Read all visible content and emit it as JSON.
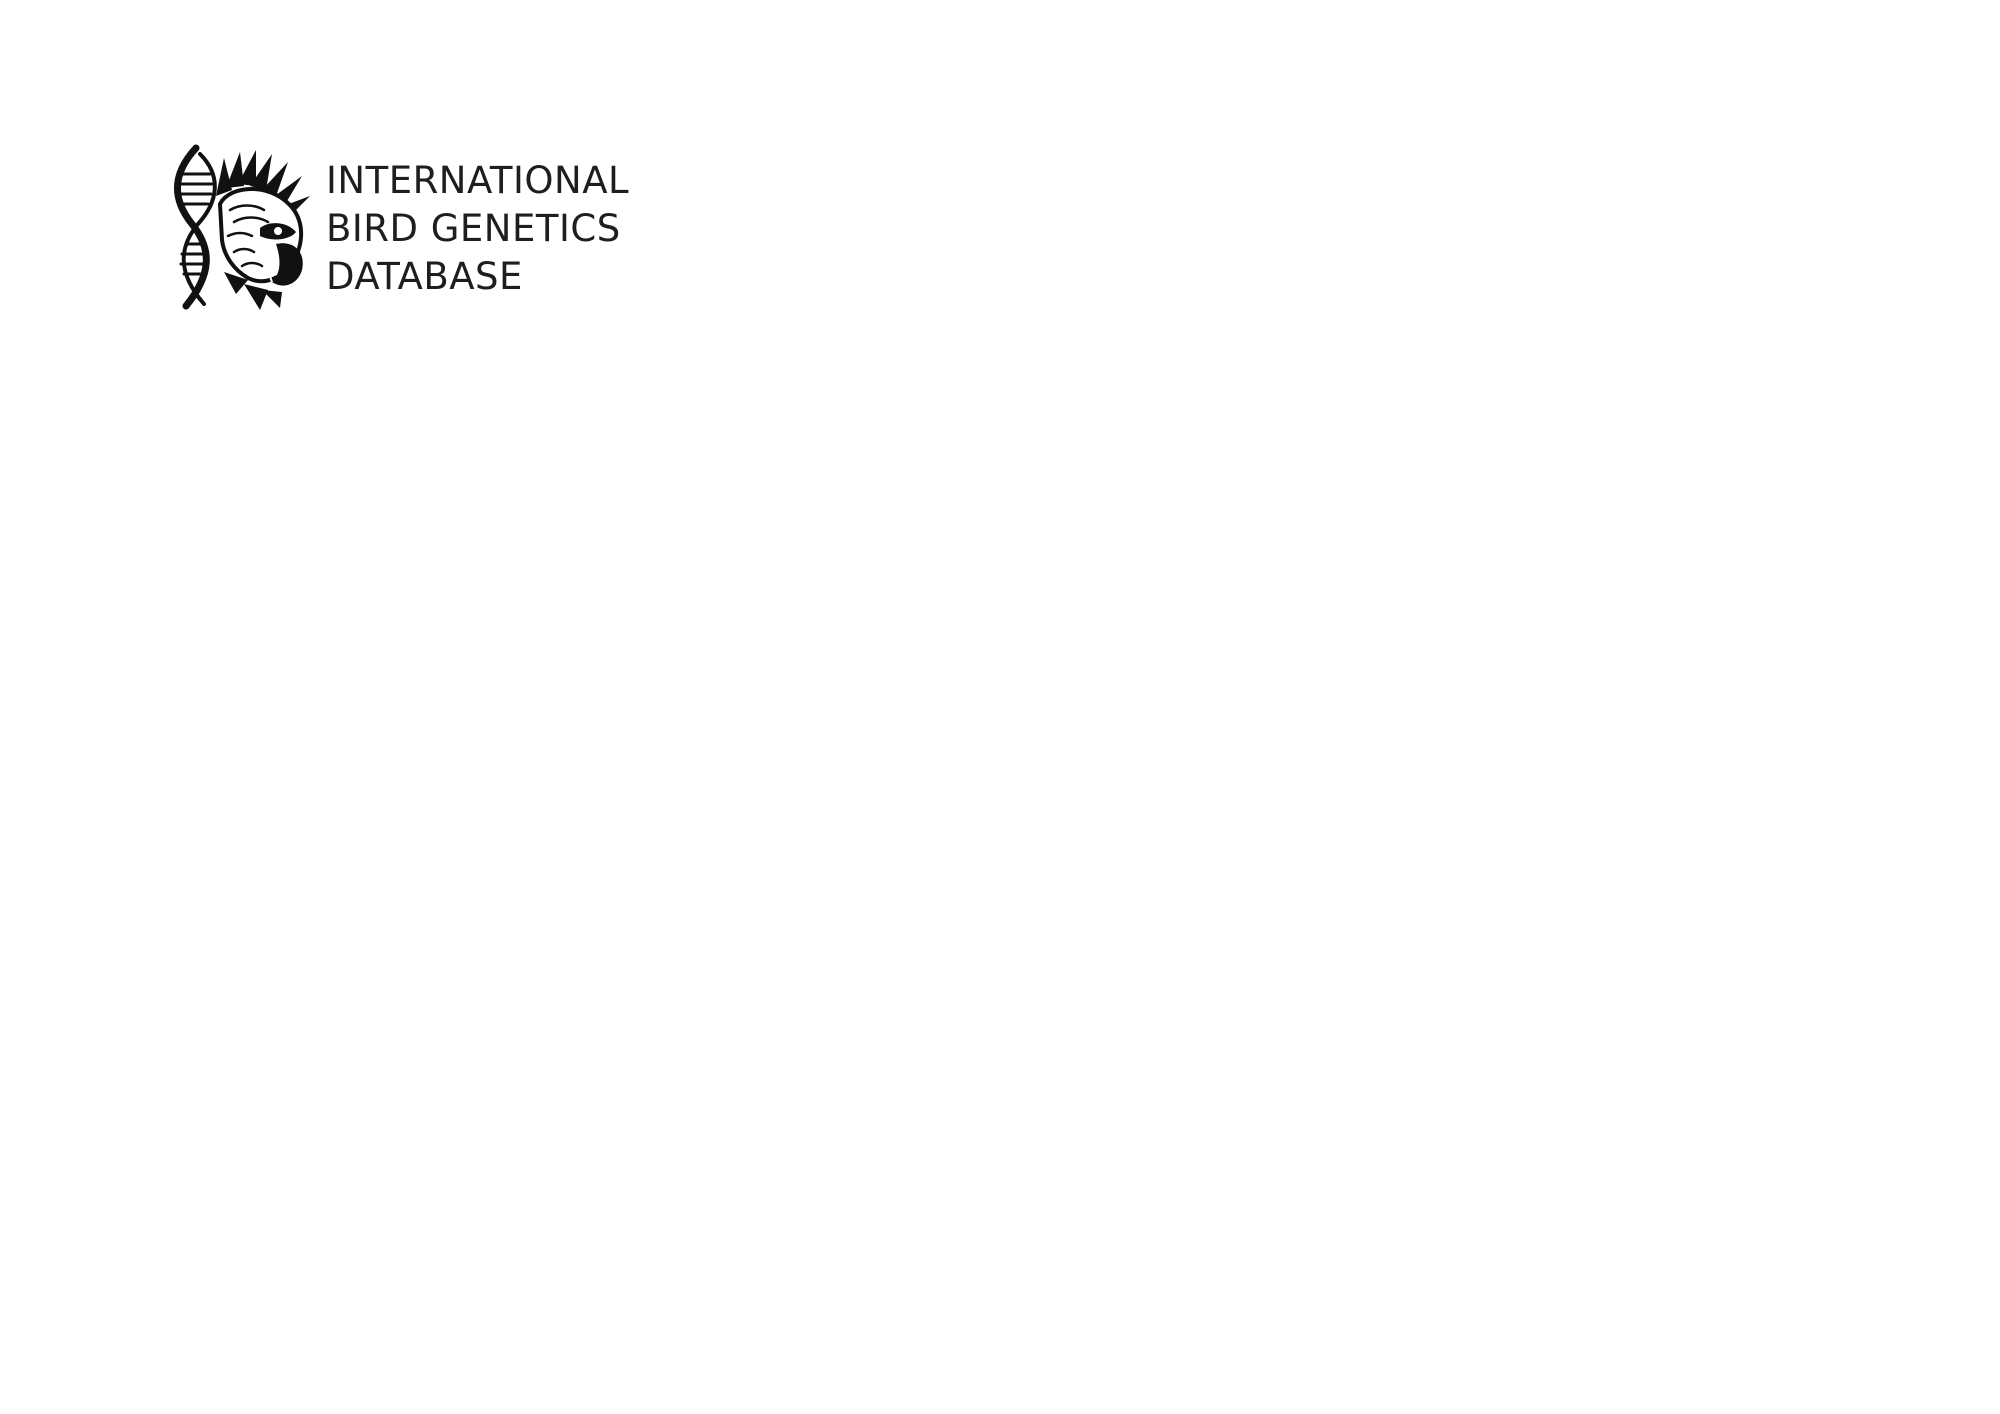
{
  "logo": {
    "mark_icon": "dna-parrot-head-icon",
    "lines": [
      "INTERNATIONAL",
      "BIRD GENETICS",
      "DATABASE"
    ],
    "text_color": "#1e1e1e",
    "mark_color": "#111111"
  },
  "page": {
    "background": "#ffffff"
  }
}
